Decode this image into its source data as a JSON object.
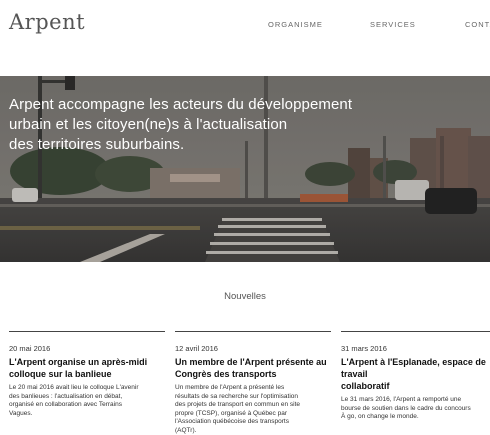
{
  "header": {
    "logo": "Arpent",
    "nav": [
      "ORGANISME",
      "SERVICES",
      "CONTACT"
    ]
  },
  "hero": {
    "lines": [
      "Arpent accompagne les acteurs du développement",
      "urbain et les citoyen(ne)s à l'actualisation",
      "des territoires suburbains."
    ]
  },
  "news": {
    "title": "Nouvelles",
    "articles": [
      {
        "date": "20 mai 2016",
        "title_lines": [
          "L'Arpent organise un après-midi",
          "colloque sur la banlieue"
        ],
        "body_lines": [
          "Le 20 mai 2016 avait lieu le colloque L'avenir",
          "des banlieues : l'actualisation en débat,",
          "organisé en collaboration avec Terrains",
          "Vagues."
        ]
      },
      {
        "date": "12 avril 2016",
        "title_lines": [
          "Un membre de l'Arpent présente au",
          "Congrès des transports"
        ],
        "body_lines": [
          "Un membre de l'Arpent a présenté les",
          "résultats de sa recherche sur l'optimisation",
          "des projets de transport en commun en site",
          "propre (TCSP), organisé à Québec par",
          "l'Association québécoise des transports",
          "(AQTr)."
        ]
      },
      {
        "date": "31 mars 2016",
        "title_lines": [
          "L'Arpent à l'Esplanade, espace de travail",
          "collaboratif"
        ],
        "body_lines": [
          "Le 31 mars 2016, l'Arpent a remporté une",
          "bourse de soutien dans le cadre du concours",
          "À go, on change le monde."
        ]
      }
    ]
  }
}
